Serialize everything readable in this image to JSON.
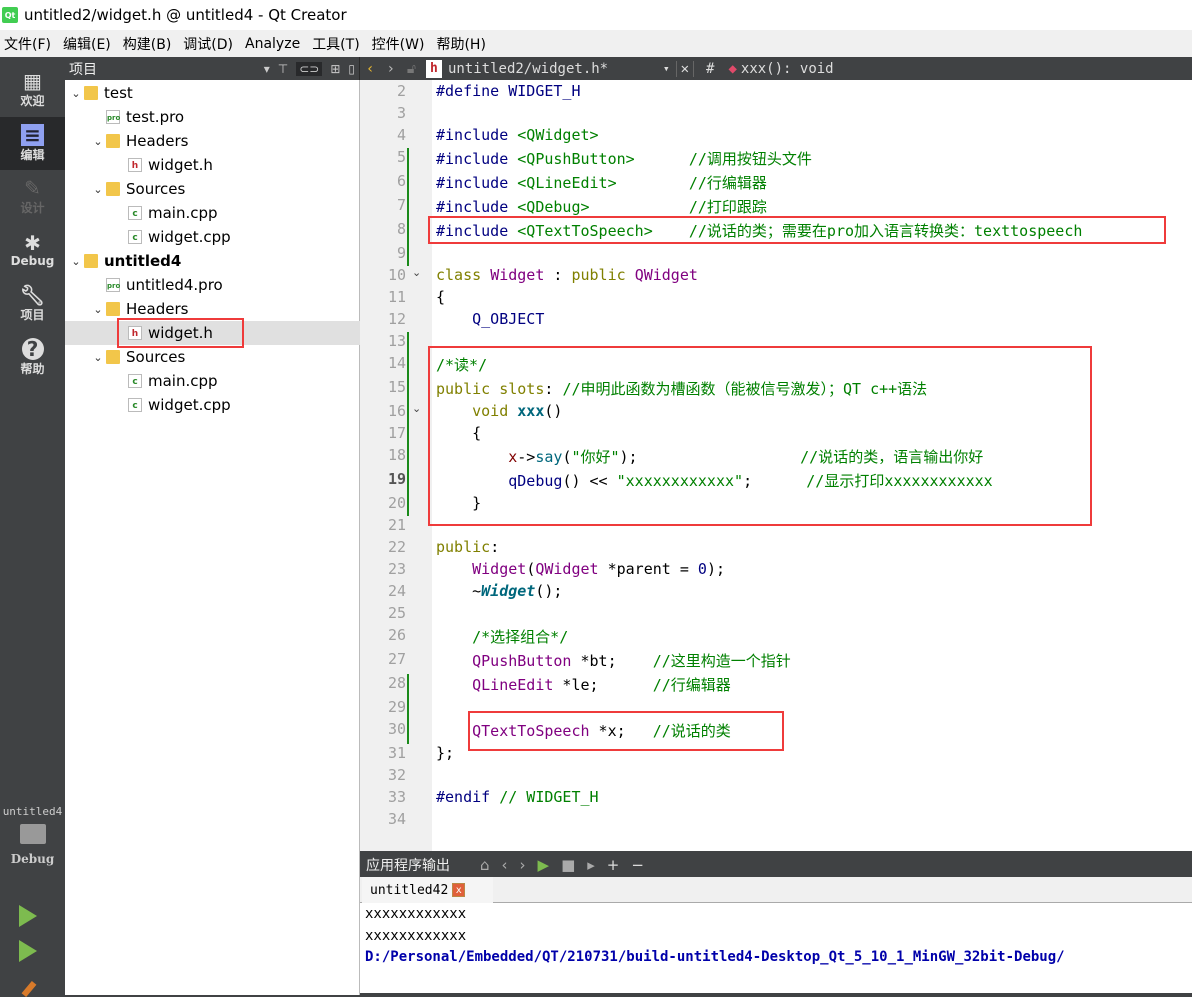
{
  "window": {
    "title": "untitled2/widget.h @ untitled4 - Qt Creator",
    "logo": "Qt"
  },
  "menu": [
    "文件(F)",
    "编辑(E)",
    "构建(B)",
    "调试(D)",
    "Analyze",
    "工具(T)",
    "控件(W)",
    "帮助(H)"
  ],
  "modes": [
    {
      "label": "欢迎",
      "icon": "grid-icon"
    },
    {
      "label": "编辑",
      "icon": "document-icon"
    },
    {
      "label": "设计",
      "icon": "pencil-icon"
    },
    {
      "label": "Debug",
      "icon": "bug-icon"
    },
    {
      "label": "项目",
      "icon": "wrench-icon"
    },
    {
      "label": "帮助",
      "icon": "help-icon"
    }
  ],
  "kit": {
    "project": "untitled4",
    "config": "Debug"
  },
  "projects_panel": {
    "title": "项目"
  },
  "tree": [
    {
      "label": "test",
      "type": "project",
      "depth": 0,
      "expanded": true
    },
    {
      "label": "test.pro",
      "type": "pro",
      "depth": 1
    },
    {
      "label": "Headers",
      "type": "folder",
      "depth": 1,
      "expanded": true
    },
    {
      "label": "widget.h",
      "type": "h",
      "depth": 2
    },
    {
      "label": "Sources",
      "type": "folder",
      "depth": 1,
      "expanded": true
    },
    {
      "label": "main.cpp",
      "type": "cpp",
      "depth": 2
    },
    {
      "label": "widget.cpp",
      "type": "cpp",
      "depth": 2
    },
    {
      "label": "untitled4",
      "type": "project",
      "depth": 0,
      "expanded": true,
      "bold": true
    },
    {
      "label": "untitled4.pro",
      "type": "pro",
      "depth": 1
    },
    {
      "label": "Headers",
      "type": "folder",
      "depth": 1,
      "expanded": true
    },
    {
      "label": "widget.h",
      "type": "h",
      "depth": 2,
      "selected": true
    },
    {
      "label": "Sources",
      "type": "folder",
      "depth": 1,
      "expanded": true
    },
    {
      "label": "main.cpp",
      "type": "cpp",
      "depth": 2
    },
    {
      "label": "widget.cpp",
      "type": "cpp",
      "depth": 2
    }
  ],
  "editor": {
    "file": "untitled2/widget.h*",
    "hash": "#",
    "symbol": "xxx(): void",
    "current_line": 19,
    "lines": [
      {
        "n": 2,
        "t": [
          [
            "pre",
            "#define "
          ],
          [
            "mac",
            "WIDGET_H"
          ]
        ]
      },
      {
        "n": 3,
        "t": []
      },
      {
        "n": 4,
        "t": [
          [
            "pre",
            "#include "
          ],
          [
            "inc",
            "<QWidget>"
          ]
        ]
      },
      {
        "n": 5,
        "t": [
          [
            "pre",
            "#include "
          ],
          [
            "inc",
            "<QPushButton>"
          ],
          [
            "",
            "      "
          ],
          [
            "cm",
            "//调用按钮头文件"
          ]
        ]
      },
      {
        "n": 6,
        "t": [
          [
            "pre",
            "#include "
          ],
          [
            "inc",
            "<QLineEdit>"
          ],
          [
            "",
            "        "
          ],
          [
            "cm",
            "//行编辑器"
          ]
        ]
      },
      {
        "n": 7,
        "t": [
          [
            "pre",
            "#include "
          ],
          [
            "inc",
            "<QDebug>"
          ],
          [
            "",
            "           "
          ],
          [
            "cm",
            "//打印跟踪"
          ]
        ]
      },
      {
        "n": 8,
        "t": [
          [
            "pre",
            "#include "
          ],
          [
            "inc",
            "<QTextToSpeech>"
          ],
          [
            "",
            "    "
          ],
          [
            "cm",
            "//说话的类；需要在pro加入语言转换类：texttospeech"
          ]
        ]
      },
      {
        "n": 9,
        "t": []
      },
      {
        "n": 10,
        "t": [
          [
            "kw",
            "class "
          ],
          [
            "type",
            "Widget"
          ],
          [
            "",
            " : "
          ],
          [
            "kw",
            "public "
          ],
          [
            "type",
            "QWidget"
          ]
        ]
      },
      {
        "n": 11,
        "t": [
          [
            "",
            "{"
          ]
        ]
      },
      {
        "n": 12,
        "t": [
          [
            "",
            "    "
          ],
          [
            "mac",
            "Q_OBJECT"
          ]
        ]
      },
      {
        "n": 13,
        "t": []
      },
      {
        "n": 14,
        "t": [
          [
            "cm",
            "/*读*/"
          ]
        ]
      },
      {
        "n": 15,
        "t": [
          [
            "kw",
            "public slots"
          ],
          [
            "",
            ": "
          ],
          [
            "cm",
            "//申明此函数为槽函数（能被信号激发）；QT c++语法"
          ]
        ]
      },
      {
        "n": 16,
        "t": [
          [
            "",
            "    "
          ],
          [
            "kw",
            "void "
          ],
          [
            "fnb",
            "xxx"
          ],
          [
            "",
            "()"
          ]
        ]
      },
      {
        "n": 17,
        "t": [
          [
            "",
            "    {"
          ]
        ]
      },
      {
        "n": 18,
        "t": [
          [
            "",
            "        "
          ],
          [
            "mem",
            "x"
          ],
          [
            "",
            "->"
          ],
          [
            "fn",
            "say"
          ],
          [
            "",
            "("
          ],
          [
            "str",
            "\"你好\""
          ],
          [
            "",
            ");"
          ],
          [
            "",
            "                  "
          ],
          [
            "cm",
            "//说话的类，语言输出你好"
          ]
        ]
      },
      {
        "n": 19,
        "t": [
          [
            "",
            "        "
          ],
          [
            "mac",
            "qDebug"
          ],
          [
            "",
            "() << "
          ],
          [
            "str",
            "\"xxxxxxxxxxxx\""
          ],
          [
            "",
            ";"
          ],
          [
            "",
            "      "
          ],
          [
            "cm",
            "//显示打印xxxxxxxxxxxx"
          ]
        ]
      },
      {
        "n": 20,
        "t": [
          [
            "",
            "    }"
          ]
        ]
      },
      {
        "n": 21,
        "t": []
      },
      {
        "n": 22,
        "t": [
          [
            "kw",
            "public"
          ],
          [
            "",
            ":"
          ]
        ]
      },
      {
        "n": 23,
        "t": [
          [
            "",
            "    "
          ],
          [
            "type",
            "Widget"
          ],
          [
            "",
            "("
          ],
          [
            "type",
            "QWidget"
          ],
          [
            "",
            " *parent = "
          ],
          [
            "num",
            "0"
          ],
          [
            "",
            ");"
          ]
        ]
      },
      {
        "n": 24,
        "t": [
          [
            "",
            "    ~"
          ],
          [
            "fni",
            "Widget"
          ],
          [
            "",
            "();"
          ]
        ]
      },
      {
        "n": 25,
        "t": []
      },
      {
        "n": 26,
        "t": [
          [
            "",
            "    "
          ],
          [
            "cm",
            "/*选择组合*/"
          ]
        ]
      },
      {
        "n": 27,
        "t": [
          [
            "",
            "    "
          ],
          [
            "type",
            "QPushButton"
          ],
          [
            "",
            " *bt;    "
          ],
          [
            "cm",
            "//这里构造一个指针"
          ]
        ]
      },
      {
        "n": 28,
        "t": [
          [
            "",
            "    "
          ],
          [
            "type",
            "QLineEdit"
          ],
          [
            "",
            " *le;      "
          ],
          [
            "cm",
            "//行编辑器"
          ]
        ]
      },
      {
        "n": 29,
        "t": []
      },
      {
        "n": 30,
        "t": [
          [
            "",
            "    "
          ],
          [
            "type",
            "QTextToSpeech"
          ],
          [
            "",
            " *x;   "
          ],
          [
            "cm",
            "//说话的类"
          ]
        ]
      },
      {
        "n": 31,
        "t": [
          [
            "",
            "};"
          ]
        ]
      },
      {
        "n": 32,
        "t": []
      },
      {
        "n": 33,
        "t": [
          [
            "pre",
            "#endif "
          ],
          [
            "cm",
            "// WIDGET_H"
          ]
        ]
      },
      {
        "n": 34,
        "t": []
      }
    ]
  },
  "output": {
    "title": "应用程序输出",
    "tab": "untitled42",
    "lines": [
      "xxxxxxxxxxxx",
      "xxxxxxxxxxxx"
    ],
    "path": "D:/Personal/Embedded/QT/210731/build-untitled4-Desktop_Qt_5_10_1_MinGW_32bit-Debug/"
  },
  "colors": {
    "dark": "#404244",
    "highlight_box": "#ef3b3b",
    "change_bar": "#1a8a1a"
  }
}
